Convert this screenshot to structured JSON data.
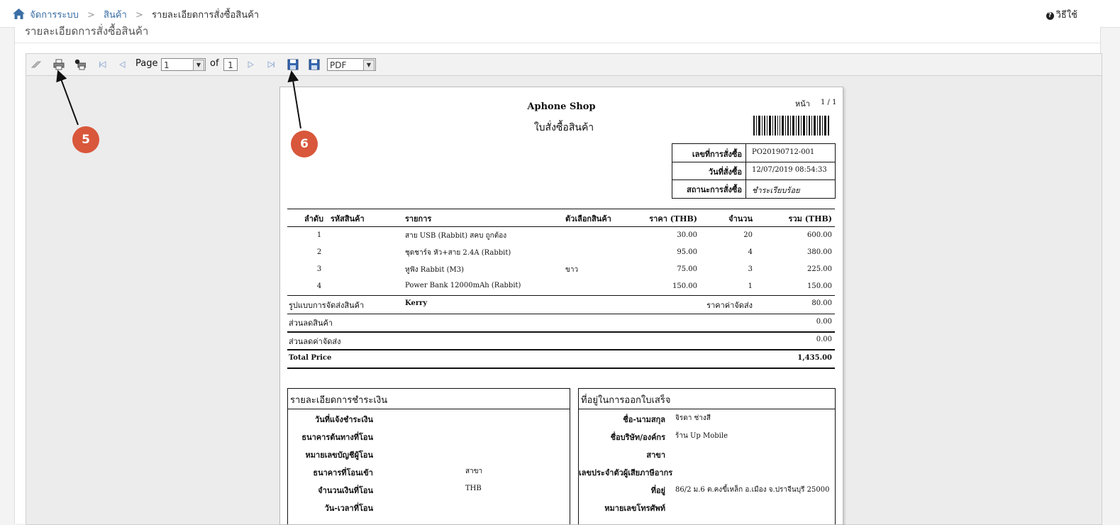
{
  "breadcrumb": {
    "home": "จัดการระบบ",
    "category": "สินค้า",
    "current": "รายละเอียดการสั่งซื้อสินค้า"
  },
  "help": {
    "label": "วิธีใช้"
  },
  "panel": {
    "title": "รายละเอียดการสั่งซื้อสินค้า"
  },
  "toolbar": {
    "page_label": "Page",
    "page_value": "1",
    "of_label": "of",
    "total_pages": "1",
    "export_format": "PDF"
  },
  "report": {
    "shop_name": "Aphone Shop",
    "doc_title": "ใบสั่งซื้อสินค้า",
    "page_label": "หน้า",
    "page_number": "1 / 1",
    "meta": [
      {
        "label": "เลขที่การสั่งซื้อ",
        "value": "PO20190712-001"
      },
      {
        "label": "วันที่สั่งซื้อ",
        "value": "12/07/2019 08:54:33"
      },
      {
        "label": "สถานะการสั่งซื้อ",
        "value": "ชำระเรียบร้อย"
      }
    ],
    "columns": {
      "no": "ลำดับ",
      "code": "รหัสสินค้า",
      "item": "รายการ",
      "option": "ตัวเลือกสินค้า",
      "price": "ราคา (THB)",
      "qty": "จำนวน",
      "total": "รวม (THB)"
    },
    "items": [
      {
        "no": "1",
        "code": "",
        "item": "สาย USB (Rabbit) สคบ ถูกต้อง",
        "option": "",
        "price": "30.00",
        "qty": "20",
        "total": "600.00"
      },
      {
        "no": "2",
        "code": "",
        "item": "ชุดชาร์จ หัว+สาย 2.4A (Rabbit)",
        "option": "",
        "price": "95.00",
        "qty": "4",
        "total": "380.00"
      },
      {
        "no": "3",
        "code": "",
        "item": "หูฟัง Rabbit (M3)",
        "option": "ขาว",
        "price": "75.00",
        "qty": "3",
        "total": "225.00"
      },
      {
        "no": "4",
        "code": "",
        "item": "Power Bank 12000mAh (Rabbit)",
        "option": "",
        "price": "150.00",
        "qty": "1",
        "total": "150.00"
      }
    ],
    "shipping_label": "รูปแบบการจัดส่งสินค้า",
    "shipping_method": "Kerry",
    "shipping_cost_label": "ราคาค่าจัดส่ง",
    "shipping_cost": "80.00",
    "product_discount_label": "ส่วนลดสินค้า",
    "product_discount": "0.00",
    "shipping_discount_label": "ส่วนลดค่าจัดส่ง",
    "shipping_discount": "0.00",
    "total_label": "Total Price",
    "total_value": "1,435.00",
    "payment": {
      "title": "รายละเอียดการชำระเงิน",
      "rows": [
        {
          "label": "วันที่แจ้งชำระเงิน",
          "value": ""
        },
        {
          "label": "ธนาคารต้นทางที่โอน",
          "value": ""
        },
        {
          "label": "หมายเลขบัญชีผู้โอน",
          "value": ""
        },
        {
          "label": "ธนาคารที่โอนเข้า",
          "value": "สาขา"
        },
        {
          "label": "จำนวนเงินที่โอน",
          "value": "THB"
        },
        {
          "label": "วัน-เวลาที่โอน",
          "value": ""
        }
      ]
    },
    "billing": {
      "title": "ที่อยู่ในการออกใบเสร็จ",
      "rows": [
        {
          "label": "ชื่อ-นามสกุล",
          "value": "จิรดา ช่างสี"
        },
        {
          "label": "ชื่อบริษัท/องค์กร",
          "value": "ร้าน Up Mobile"
        },
        {
          "label": "สาขา",
          "value": ""
        },
        {
          "label": "เลขประจำตัวผู้เสียภาษีอากร",
          "value": ""
        },
        {
          "label": "ที่อยู่",
          "value": "86/2 ม.6 ต.คงขี้เหล็ก อ.เมือง จ.ปราจีนบุรี 25000"
        },
        {
          "label": "หมายเลขโทรศัพท์",
          "value": ""
        }
      ]
    }
  },
  "callouts": {
    "first": "5",
    "second": "6"
  },
  "colors": {
    "link": "#3a6ea5",
    "callout": "#d9573b"
  }
}
